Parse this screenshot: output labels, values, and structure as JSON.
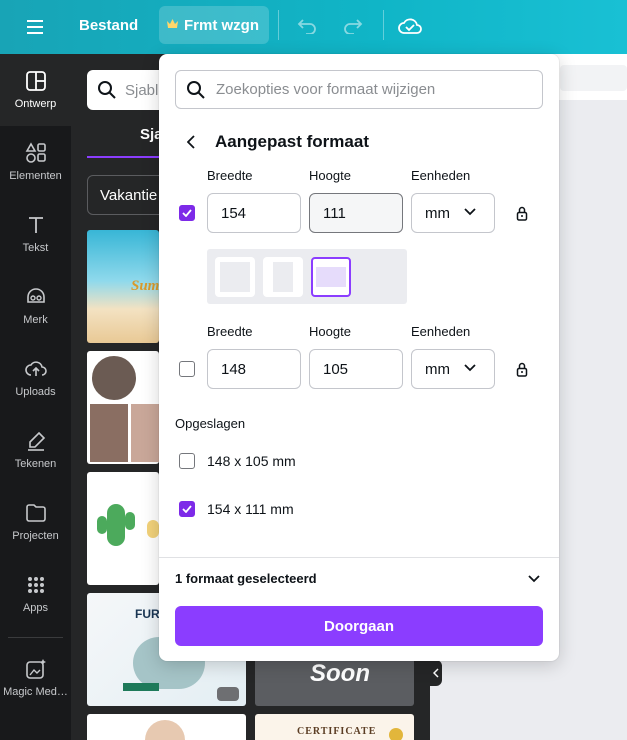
{
  "topbar": {
    "file_label": "Bestand",
    "resize_label": "Frmt wzgn",
    "resize_icon": "crown-icon"
  },
  "rail": {
    "items": [
      {
        "label": "Ontwerp",
        "icon": "layout-icon"
      },
      {
        "label": "Elementen",
        "icon": "shapes-icon"
      },
      {
        "label": "Tekst",
        "icon": "text-icon"
      },
      {
        "label": "Merk",
        "icon": "brand-icon"
      },
      {
        "label": "Uploads",
        "icon": "cloud-upload-icon"
      },
      {
        "label": "Tekenen",
        "icon": "draw-icon"
      },
      {
        "label": "Projecten",
        "icon": "folder-icon"
      },
      {
        "label": "Apps",
        "icon": "apps-grid-icon"
      },
      {
        "label": "Magic Med…",
        "icon": "magic-media-icon"
      }
    ]
  },
  "panel": {
    "search_placeholder": "Sjabl",
    "tab_label": "Sja",
    "dropdown_label": "Vakantie",
    "thumb_texts": {
      "summer": "Sum",
      "soon": "Soon",
      "certificate": "CERTIFICATE",
      "furniture": "FUR"
    }
  },
  "popover": {
    "search_placeholder": "Zoekopties voor formaat wijzigen",
    "title": "Aangepast formaat",
    "size_rows": [
      {
        "checked": true,
        "width_label": "Breedte",
        "height_label": "Hoogte",
        "units_label": "Eenheden",
        "width": "154",
        "height": "111",
        "units": "mm"
      },
      {
        "checked": false,
        "width_label": "Breedte",
        "height_label": "Hoogte",
        "units_label": "Eenheden",
        "width": "148",
        "height": "105",
        "units": "mm"
      }
    ],
    "saved_label": "Opgeslagen",
    "saved": [
      {
        "label": "148 x 105 mm",
        "checked": false
      },
      {
        "label": "154 x 111 mm",
        "checked": true
      }
    ],
    "selected_count": "1 formaat geselecteerd",
    "continue_label": "Doorgaan"
  },
  "colors": {
    "accent": "#8b3dff",
    "checkbox": "#7d2ae8",
    "topbar": "#10b5c7",
    "rail": "#18191b"
  }
}
